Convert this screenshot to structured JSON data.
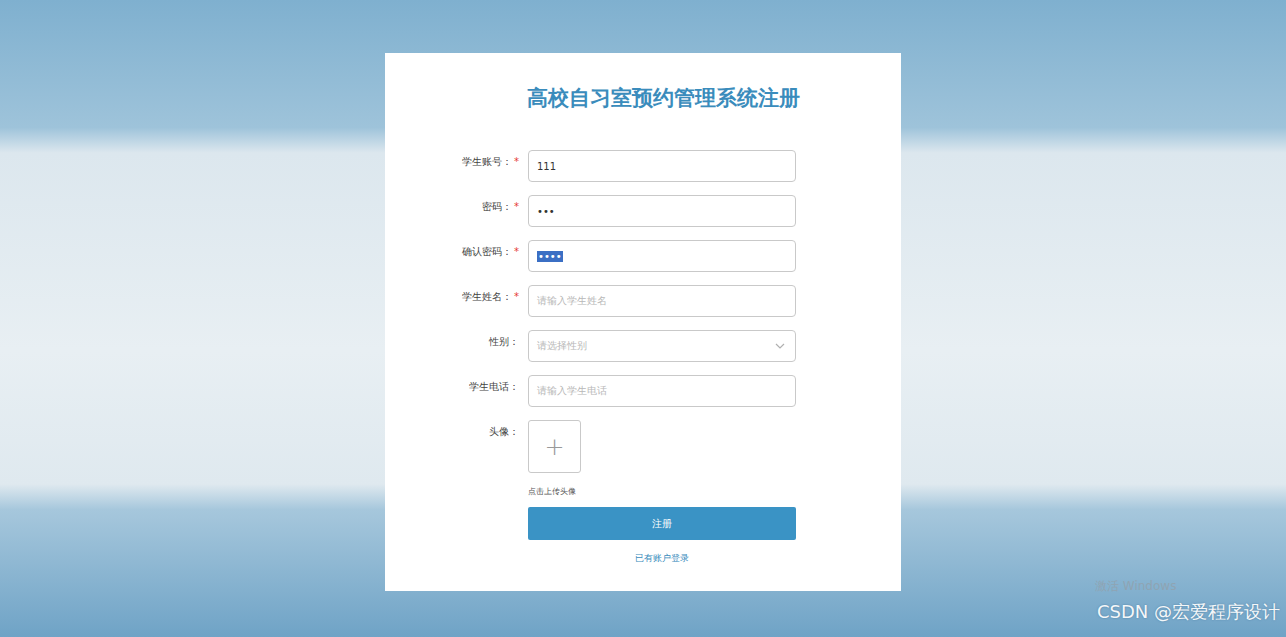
{
  "window": {
    "title": "高校自习室预约管理系统注册"
  },
  "fields": [
    {
      "label": "学生账号：",
      "required": true,
      "kind": "text",
      "value": "111",
      "placeholder": "",
      "highlighted": false
    },
    {
      "label": "密码：",
      "required": true,
      "kind": "password",
      "value": "•••",
      "placeholder": "",
      "highlighted": false
    },
    {
      "label": "确认密码：",
      "required": true,
      "kind": "password",
      "value": "••••",
      "placeholder": "",
      "highlighted": true
    },
    {
      "label": "学生姓名：",
      "required": true,
      "kind": "text",
      "value": "",
      "placeholder": "请输入学生姓名",
      "highlighted": false
    },
    {
      "label": "性别：",
      "required": false,
      "kind": "select",
      "value": "",
      "placeholder": "请选择性别",
      "highlighted": false
    },
    {
      "label": "学生电话：",
      "required": false,
      "kind": "text",
      "value": "",
      "placeholder": "请输入学生电话",
      "highlighted": false
    }
  ],
  "avatar": {
    "label": "头像：",
    "icon": "+",
    "hint": "点击上传头像"
  },
  "required_mark": "*",
  "submit": "注册",
  "login_link": "已有账户登录",
  "watermarks": {
    "os": "激活 Windows",
    "source": "CSDN @宏爱程序设计"
  }
}
